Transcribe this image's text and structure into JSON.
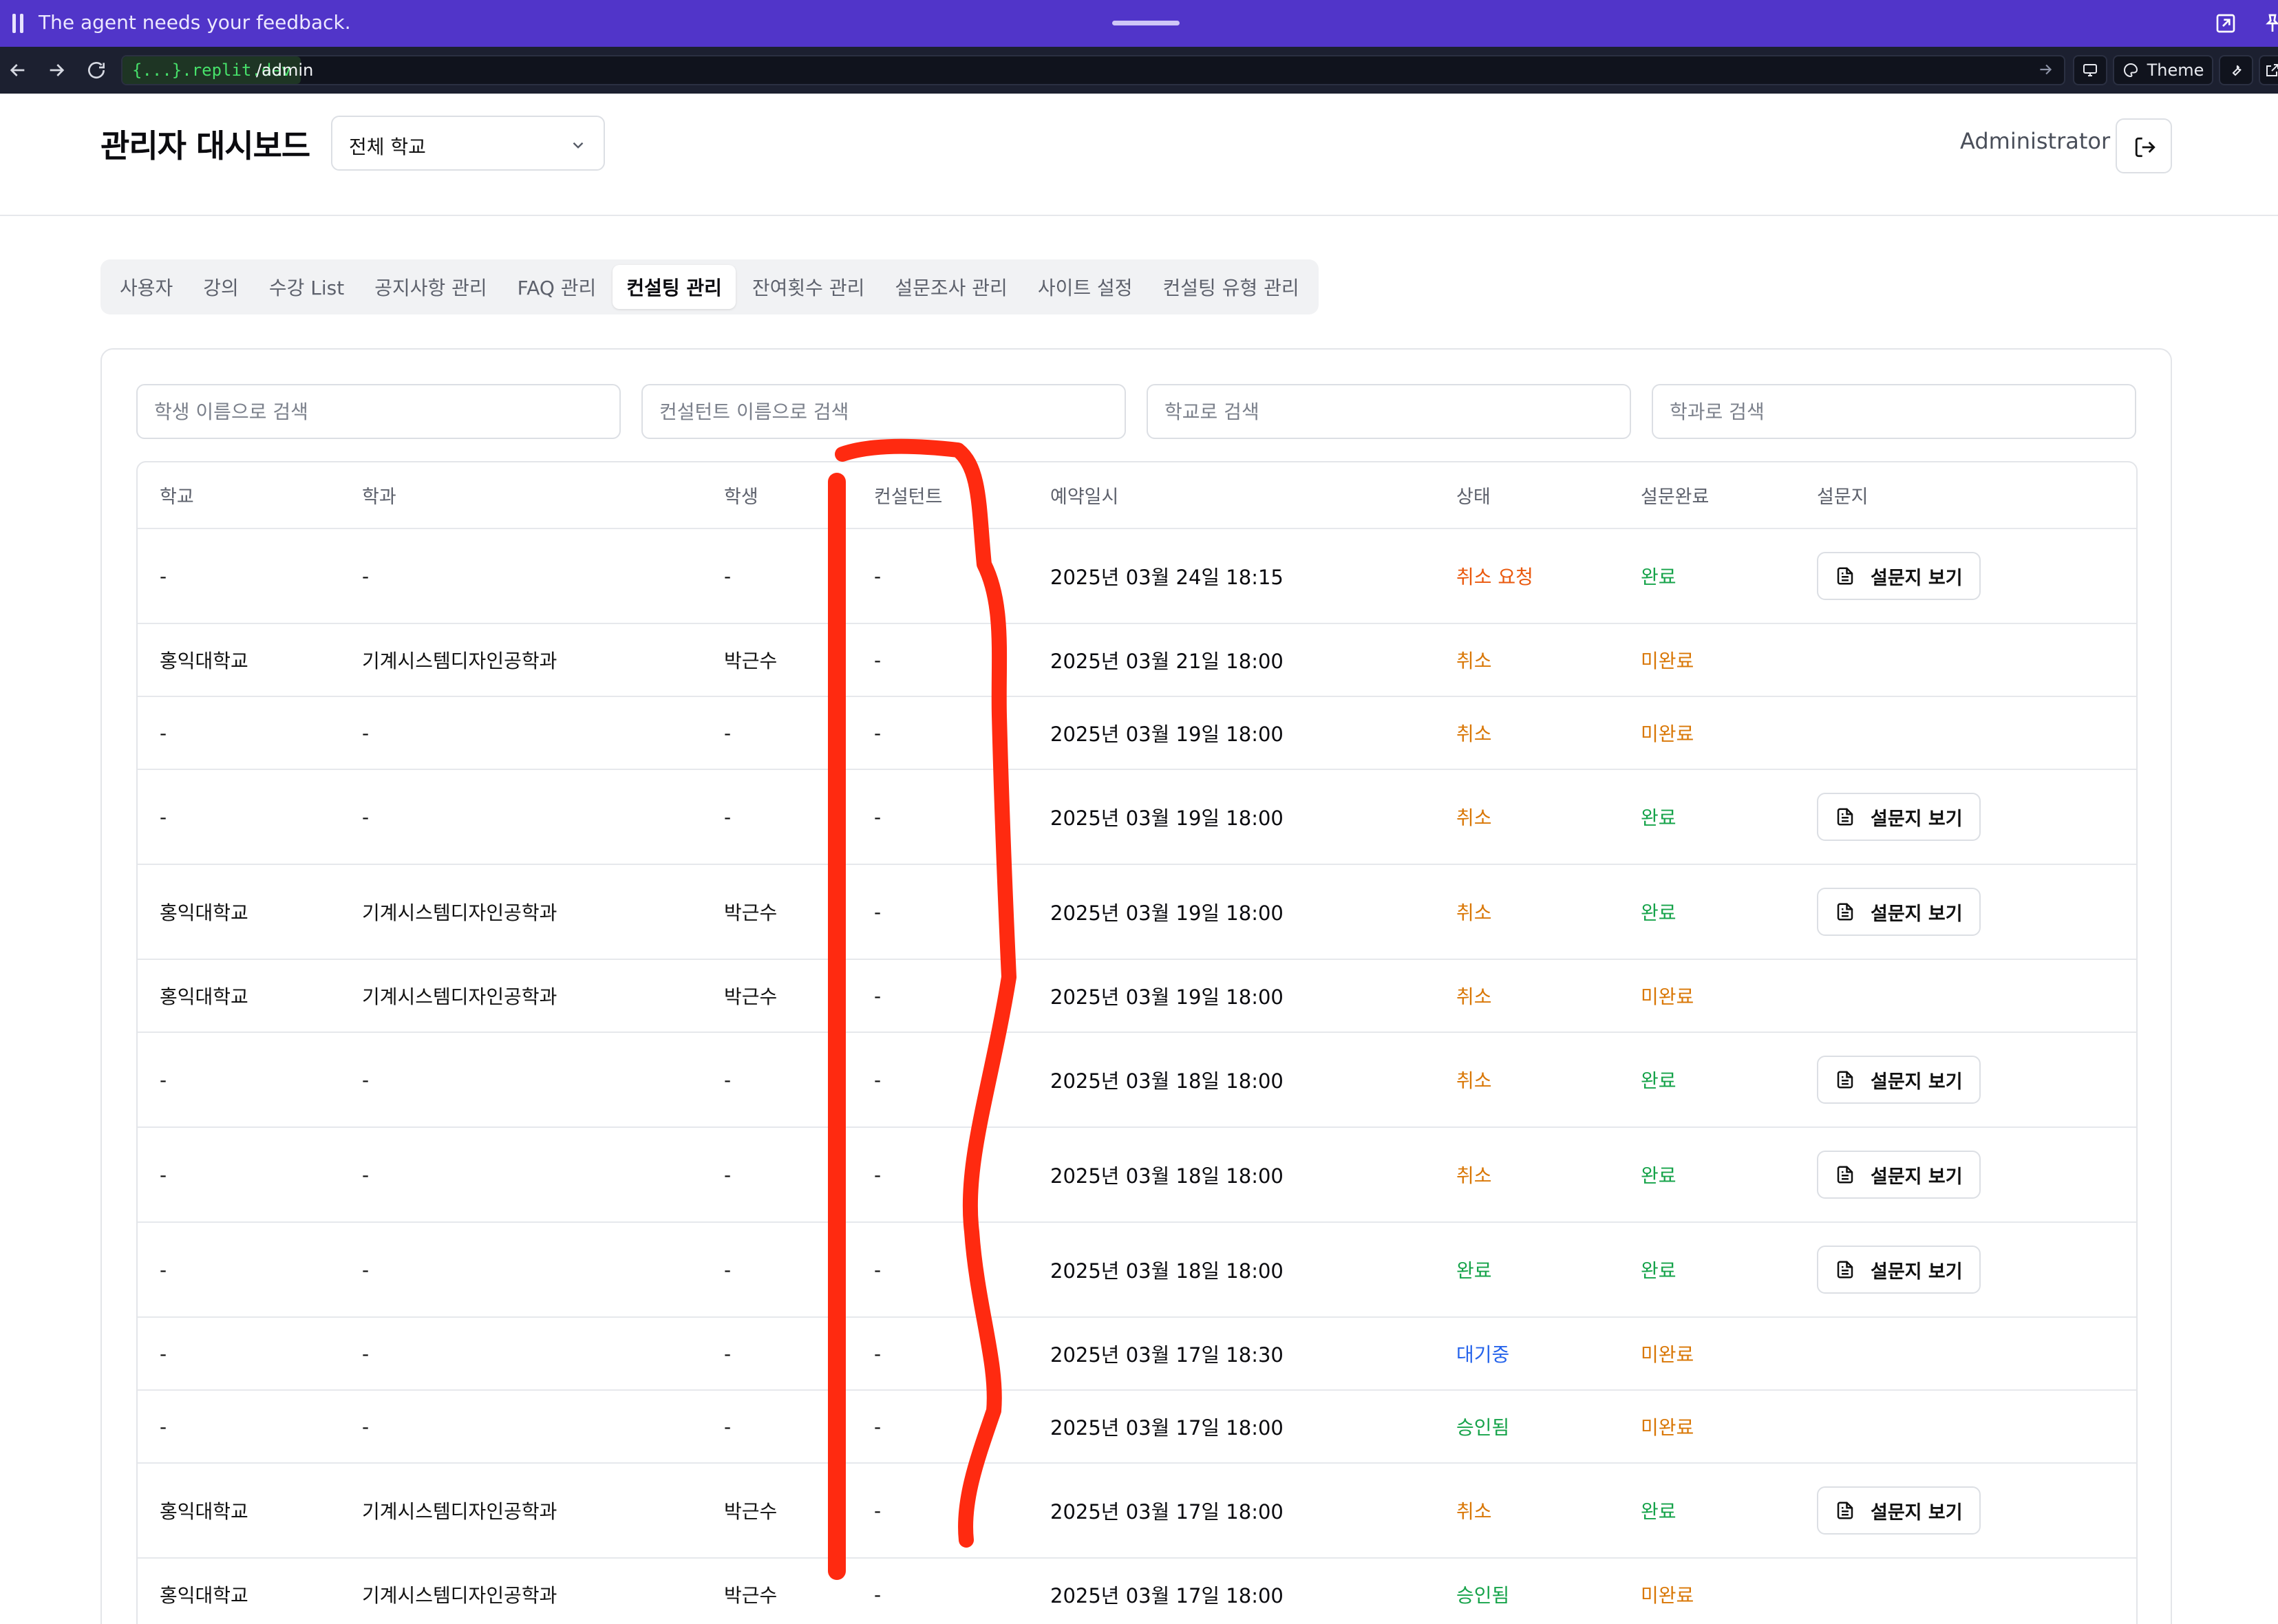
{
  "agent_bar": {
    "message": "The agent needs your feedback.",
    "icons": [
      "pause-icon",
      "popout-icon",
      "pin-icon"
    ]
  },
  "browser": {
    "domain": "{...}.replit.dev",
    "path": "/admin",
    "theme_label": "Theme",
    "icons": [
      "back-icon",
      "forward-icon",
      "reload-icon",
      "go-icon",
      "devices-icon",
      "palette-icon",
      "wrench-icon",
      "external-link-icon"
    ]
  },
  "header": {
    "title": "관리자 대시보드",
    "school_select": "전체 학교",
    "admin_name": "Administrator",
    "logout_icon": "logout-icon"
  },
  "tabs": [
    {
      "label": "사용자",
      "active": false
    },
    {
      "label": "강의",
      "active": false
    },
    {
      "label": "수강 List",
      "active": false
    },
    {
      "label": "공지사항 관리",
      "active": false
    },
    {
      "label": "FAQ 관리",
      "active": false
    },
    {
      "label": "컨설팅 관리",
      "active": true
    },
    {
      "label": "잔여횟수 관리",
      "active": false
    },
    {
      "label": "설문조사 관리",
      "active": false
    },
    {
      "label": "사이트 설정",
      "active": false
    },
    {
      "label": "컨설팅 유형 관리",
      "active": false
    }
  ],
  "search": {
    "student_placeholder": "학생 이름으로 검색",
    "consultant_placeholder": "컨설턴트 이름으로 검색",
    "school_placeholder": "학교로 검색",
    "department_placeholder": "학과로 검색"
  },
  "table": {
    "columns": [
      "학교",
      "학과",
      "학생",
      "컨설턴트",
      "예약일시",
      "상태",
      "설문완료",
      "설문지"
    ],
    "survey_button_label": "설문지 보기",
    "status_colors": {
      "취소 요청": "#ea580c",
      "취소": "#d97706",
      "완료": "#16a34a",
      "대기중": "#2563eb",
      "승인됨": "#16a34a",
      "미완료": "#d97706"
    },
    "rows": [
      {
        "school": "-",
        "department": "-",
        "student": "-",
        "consultant": "-",
        "datetime": "2025년 03월 24일 18:15",
        "status": "취소 요청",
        "survey_done": "완료",
        "has_survey": true
      },
      {
        "school": "홍익대학교",
        "department": "기계시스템디자인공학과",
        "student": "박근수",
        "consultant": "-",
        "datetime": "2025년 03월 21일 18:00",
        "status": "취소",
        "survey_done": "미완료",
        "has_survey": false
      },
      {
        "school": "-",
        "department": "-",
        "student": "-",
        "consultant": "-",
        "datetime": "2025년 03월 19일 18:00",
        "status": "취소",
        "survey_done": "미완료",
        "has_survey": false
      },
      {
        "school": "-",
        "department": "-",
        "student": "-",
        "consultant": "-",
        "datetime": "2025년 03월 19일 18:00",
        "status": "취소",
        "survey_done": "완료",
        "has_survey": true
      },
      {
        "school": "홍익대학교",
        "department": "기계시스템디자인공학과",
        "student": "박근수",
        "consultant": "-",
        "datetime": "2025년 03월 19일 18:00",
        "status": "취소",
        "survey_done": "완료",
        "has_survey": true
      },
      {
        "school": "홍익대학교",
        "department": "기계시스템디자인공학과",
        "student": "박근수",
        "consultant": "-",
        "datetime": "2025년 03월 19일 18:00",
        "status": "취소",
        "survey_done": "미완료",
        "has_survey": false
      },
      {
        "school": "-",
        "department": "-",
        "student": "-",
        "consultant": "-",
        "datetime": "2025년 03월 18일 18:00",
        "status": "취소",
        "survey_done": "완료",
        "has_survey": true
      },
      {
        "school": "-",
        "department": "-",
        "student": "-",
        "consultant": "-",
        "datetime": "2025년 03월 18일 18:00",
        "status": "취소",
        "survey_done": "완료",
        "has_survey": true
      },
      {
        "school": "-",
        "department": "-",
        "student": "-",
        "consultant": "-",
        "datetime": "2025년 03월 18일 18:00",
        "status": "완료",
        "survey_done": "완료",
        "has_survey": true
      },
      {
        "school": "-",
        "department": "-",
        "student": "-",
        "consultant": "-",
        "datetime": "2025년 03월 17일 18:30",
        "status": "대기중",
        "survey_done": "미완료",
        "has_survey": false
      },
      {
        "school": "-",
        "department": "-",
        "student": "-",
        "consultant": "-",
        "datetime": "2025년 03월 17일 18:00",
        "status": "승인됨",
        "survey_done": "미완료",
        "has_survey": false
      },
      {
        "school": "홍익대학교",
        "department": "기계시스템디자인공학과",
        "student": "박근수",
        "consultant": "-",
        "datetime": "2025년 03월 17일 18:00",
        "status": "취소",
        "survey_done": "완료",
        "has_survey": true
      },
      {
        "school": "홍익대학교",
        "department": "기계시스템디자인공학과",
        "student": "박근수",
        "consultant": "-",
        "datetime": "2025년 03월 17일 18:00",
        "status": "승인됨",
        "survey_done": "미완료",
        "has_survey": false
      }
    ]
  },
  "annotation": {
    "color": "#ff2a10"
  }
}
